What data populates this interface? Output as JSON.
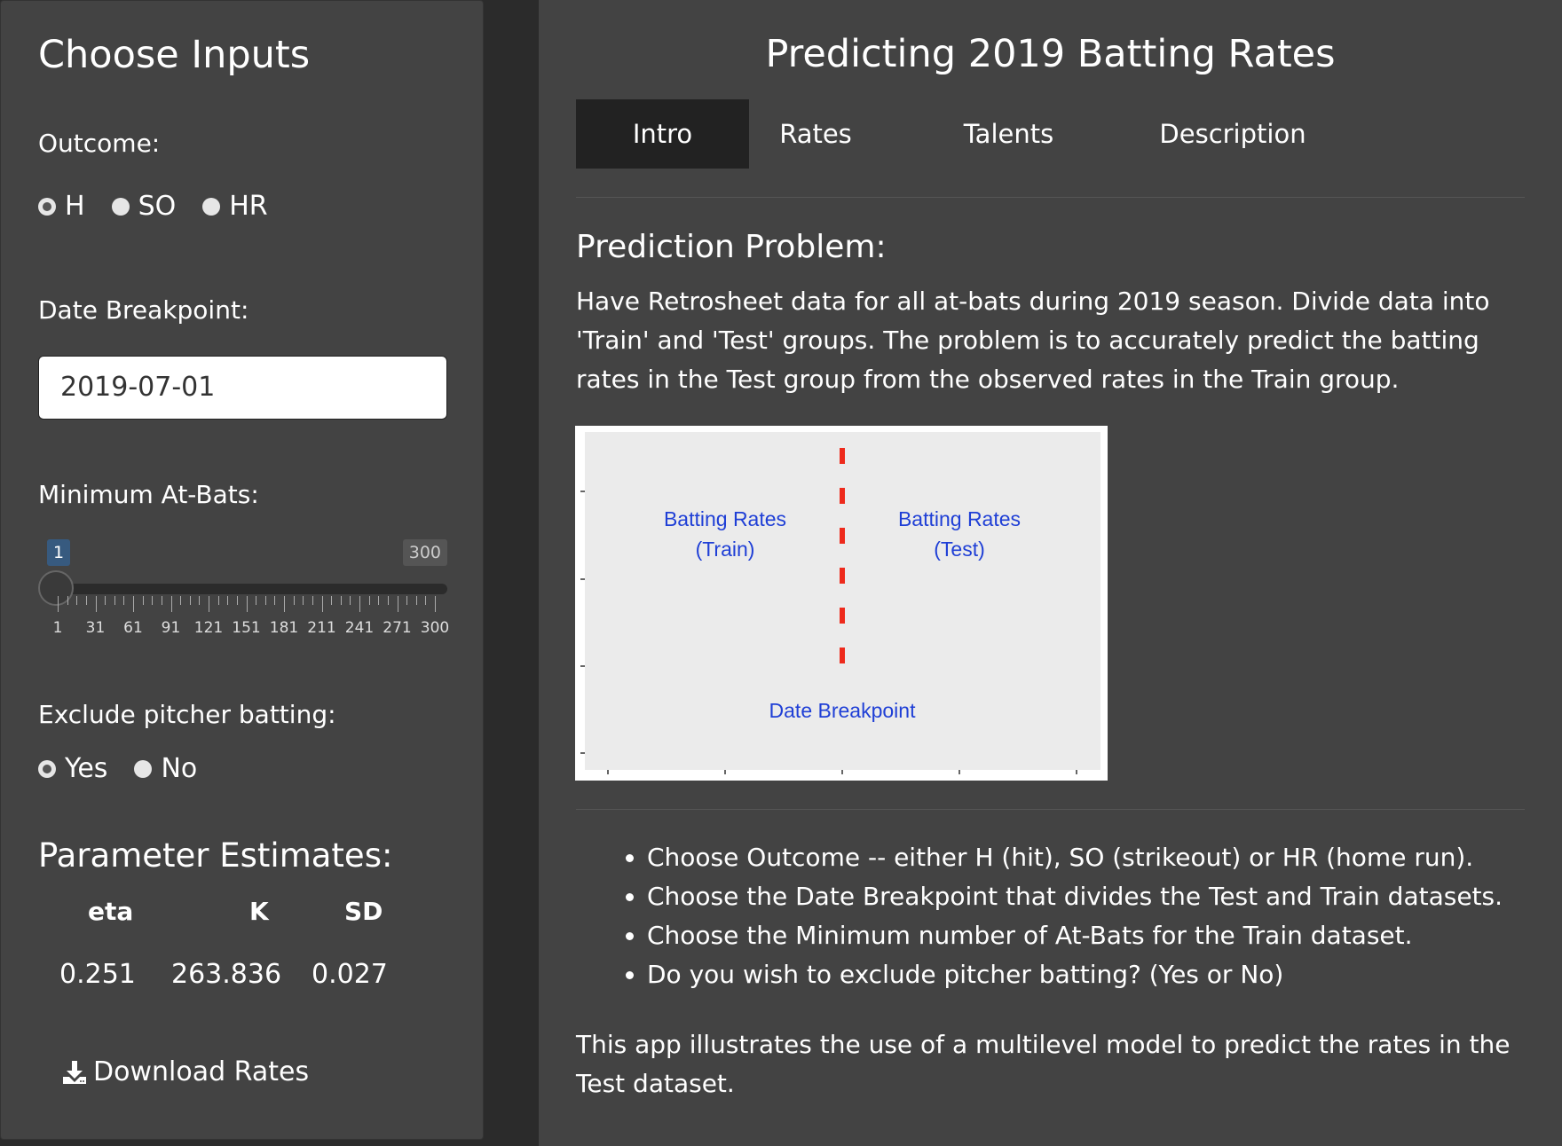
{
  "sidebar": {
    "title": "Choose Inputs",
    "outcome": {
      "label": "Outcome:",
      "options": [
        "H",
        "SO",
        "HR"
      ],
      "selected": "H"
    },
    "date_breakpoint": {
      "label": "Date Breakpoint:",
      "value": "2019-07-01"
    },
    "min_at_bats": {
      "label": "Minimum At-Bats:",
      "value": 1,
      "min": 1,
      "max": 300,
      "min_badge": "1",
      "max_badge": "300",
      "tick_labels": [
        "1",
        "31",
        "61",
        "91",
        "121",
        "151",
        "181",
        "211",
        "241",
        "271",
        "300"
      ]
    },
    "exclude_pitcher": {
      "label": "Exclude pitcher batting:",
      "options": [
        "Yes",
        "No"
      ],
      "selected": "Yes"
    },
    "parameters": {
      "title": "Parameter Estimates:",
      "headers": [
        "eta",
        "K",
        "SD"
      ],
      "values": [
        "0.251",
        "263.836",
        "0.027"
      ]
    },
    "download_label": "Download Rates"
  },
  "main": {
    "title": "Predicting 2019 Batting Rates",
    "tabs": [
      {
        "label": "Intro",
        "active": true
      },
      {
        "label": "Rates",
        "active": false
      },
      {
        "label": "Talents",
        "active": false
      },
      {
        "label": "Description",
        "active": false
      }
    ],
    "section_title": "Prediction Problem:",
    "intro_paragraph": "Have Retrosheet data for all at-bats during 2019 season. Divide data into 'Train' and 'Test' groups. The problem is to accurately predict the batting rates in the Test group from the observed rates in the Train group.",
    "figure": {
      "left_label_line1": "Batting Rates",
      "left_label_line2": "(Train)",
      "right_label_line1": "Batting Rates",
      "right_label_line2": "(Test)",
      "bottom_label": "Date Breakpoint",
      "text_color": "#1f3fd6",
      "line_color": "#ee2a1c"
    },
    "bullets": [
      "Choose Outcome -- either H (hit), SO (strikeout) or HR (home run).",
      "Choose the Date Breakpoint that divides the Test and Train datasets.",
      "Choose the Minimum number of At-Bats for the Train dataset.",
      "Do you wish to exclude pitcher batting? (Yes or No)"
    ],
    "closing_paragraph": "This app illustrates the use of a multilevel model to predict the rates in the Test dataset."
  }
}
